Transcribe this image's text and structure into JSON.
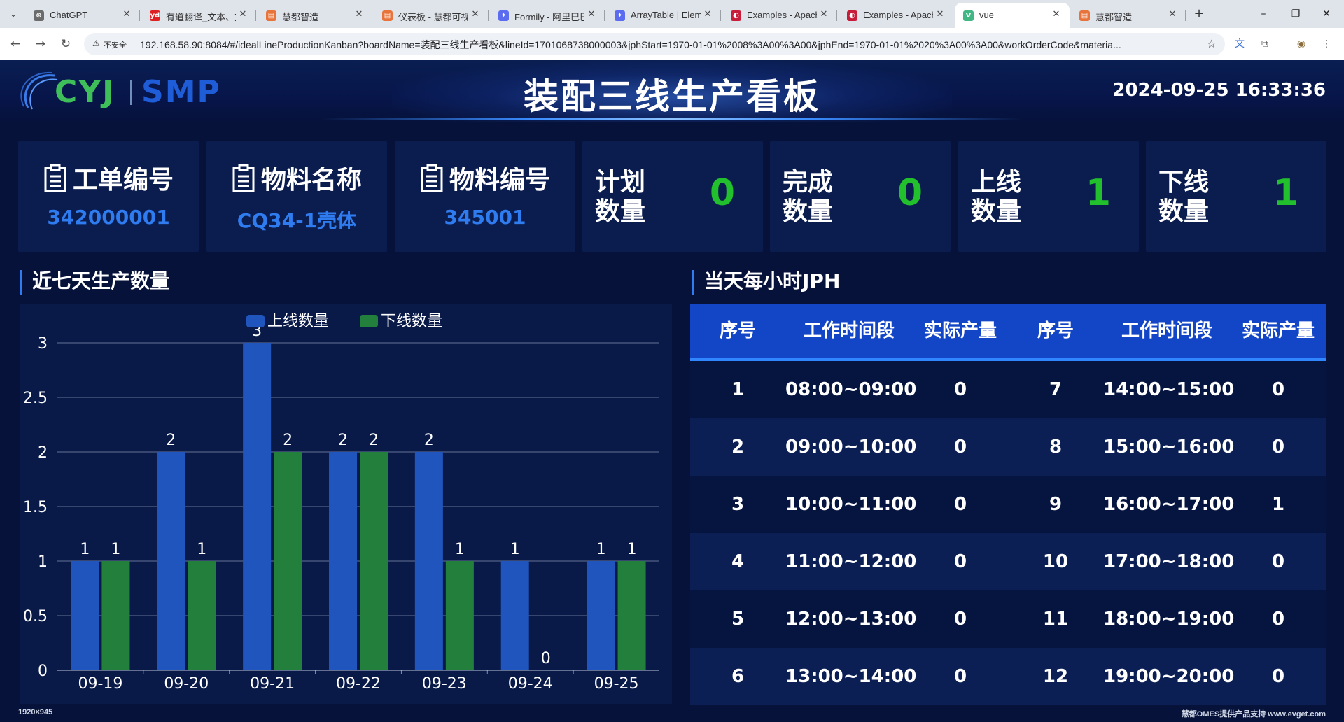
{
  "browser": {
    "tabs": [
      {
        "title": "ChatGPT",
        "icon": "chatgpt-icon",
        "color": "#6b6b6b",
        "glyph": "⊛"
      },
      {
        "title": "有道翻译_文本、文",
        "icon": "youdao-icon",
        "color": "#e02020",
        "glyph": "yd"
      },
      {
        "title": "慧都智造",
        "icon": "huidu-icon",
        "color": "#e8743b",
        "glyph": "▤"
      },
      {
        "title": "仪表板 - 慧都可视",
        "icon": "huidu-icon",
        "color": "#e8743b",
        "glyph": "▤"
      },
      {
        "title": "Formily - 阿里巴巴",
        "icon": "formily-icon",
        "color": "#5b6cf0",
        "glyph": "✦"
      },
      {
        "title": "ArrayTable | Eleme",
        "icon": "formily-icon",
        "color": "#5b6cf0",
        "glyph": "✦"
      },
      {
        "title": "Examples - Apache",
        "icon": "echarts-icon",
        "color": "#c81d3a",
        "glyph": "◐"
      },
      {
        "title": "Examples - Apache",
        "icon": "echarts-icon",
        "color": "#c81d3a",
        "glyph": "◐"
      },
      {
        "title": "vue",
        "icon": "vue-icon",
        "color": "#41b883",
        "glyph": "V"
      },
      {
        "title": "慧都智造",
        "icon": "huidu-icon",
        "color": "#e8743b",
        "glyph": "▤"
      }
    ],
    "active_tab_index": 8,
    "not_secure_label": "不安全",
    "url": "192.168.58.90:8084/#/idealLineProductionKanban?boardName=装配三线生产看板&lineId=1701068738000003&jphStart=1970-01-01%2008%3A00%3A00&jphEnd=1970-01-01%2020%3A00%3A00&workOrderCode&materia..."
  },
  "header": {
    "logo_left": "CYJ",
    "logo_right": "SMP",
    "title": "装配三线生产看板",
    "datetime": "2024-09-25 16:33:36"
  },
  "cards": {
    "work_order": {
      "label": "工单编号",
      "value": "342000001"
    },
    "material_name": {
      "label": "物料名称",
      "value": "CQ34-1壳体"
    },
    "material_code": {
      "label": "物料编号",
      "value": "345001"
    },
    "plan_qty": {
      "label": "计划数量",
      "value": "0"
    },
    "done_qty": {
      "label": "完成数量",
      "value": "0"
    },
    "online_qty": {
      "label": "上线数量",
      "value": "1"
    },
    "offline_qty": {
      "label": "下线数量",
      "value": "1"
    }
  },
  "sections": {
    "chart_title": "近七天生产数量",
    "table_title": "当天每小时JPH"
  },
  "chart_data": {
    "type": "bar",
    "categories": [
      "09-19",
      "09-20",
      "09-21",
      "09-22",
      "09-23",
      "09-24",
      "09-25"
    ],
    "series": [
      {
        "name": "上线数量",
        "values": [
          1,
          2,
          3,
          2,
          2,
          1,
          1
        ],
        "color": "#1f55bd"
      },
      {
        "name": "下线数量",
        "values": [
          1,
          1,
          2,
          2,
          1,
          0,
          1
        ],
        "color": "#23803c"
      }
    ],
    "yticks": [
      "0",
      "0.5",
      "1",
      "1.5",
      "2",
      "2.5",
      "3"
    ],
    "ylim": [
      0,
      3
    ],
    "grid": true,
    "legend": "top-center",
    "data_labels": true
  },
  "jph_table": {
    "headers": [
      "序号",
      "工作时间段",
      "实际产量",
      "序号",
      "工作时间段",
      "实际产量"
    ],
    "rows": [
      [
        "1",
        "08:00~09:00",
        "0",
        "7",
        "14:00~15:00",
        "0"
      ],
      [
        "2",
        "09:00~10:00",
        "0",
        "8",
        "15:00~16:00",
        "0"
      ],
      [
        "3",
        "10:00~11:00",
        "0",
        "9",
        "16:00~17:00",
        "1"
      ],
      [
        "4",
        "11:00~12:00",
        "0",
        "10",
        "17:00~18:00",
        "0"
      ],
      [
        "5",
        "12:00~13:00",
        "0",
        "11",
        "18:00~19:00",
        "0"
      ],
      [
        "6",
        "13:00~14:00",
        "0",
        "12",
        "19:00~20:00",
        "0"
      ]
    ]
  },
  "footer": {
    "resolution": "1920×945",
    "credit": "慧都OMES提供产品支持  www.evget.com"
  },
  "colors": {
    "background": "#06123a",
    "accent_blue": "#2f7cf0",
    "accent_green": "#22c02c",
    "table_header": "#1346c7"
  }
}
